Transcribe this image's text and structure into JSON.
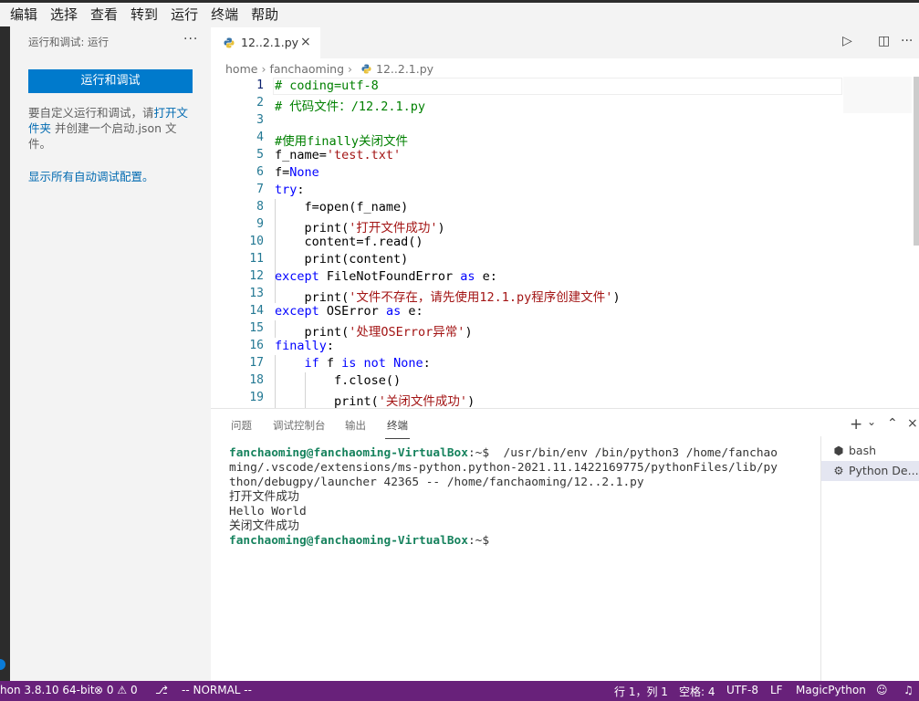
{
  "menu": [
    "编辑",
    "选择",
    "查看",
    "转到",
    "运行",
    "终端",
    "帮助"
  ],
  "sidebar": {
    "title": "运行和调试: 运行",
    "more": "···",
    "run_button": "运行和调试",
    "desc_pre": "要自定义运行和调试，请",
    "desc_link": "打开文件夹",
    "desc_post": " 并创建一个启动.json 文件。",
    "show_all": "显示所有自动调试配置。"
  },
  "tab": {
    "label": "12..2.1.py",
    "close": "×"
  },
  "editor_actions": {
    "run": "▷",
    "split": "◫",
    "more": "···"
  },
  "breadcrumb": {
    "home": "home",
    "user": "fanchaoming",
    "file": "12..2.1.py"
  },
  "editor": {
    "line_numbers": [
      "1",
      "2",
      "3",
      "4",
      "5",
      "6",
      "7",
      "8",
      "9",
      "10",
      "11",
      "12",
      "13",
      "14",
      "15",
      "16",
      "17",
      "18",
      "19"
    ],
    "lines": [
      [
        [
          "c-com",
          "# coding=utf-8"
        ]
      ],
      [
        [
          "c-com",
          "# 代码文件：/12.2.1.py"
        ]
      ],
      [],
      [
        [
          "c-com",
          "#使用finally关闭文件"
        ]
      ],
      [
        [
          "c-plain",
          "f_name="
        ],
        [
          "c-str",
          "'test.txt'"
        ]
      ],
      [
        [
          "c-plain",
          "f="
        ],
        [
          "c-kw",
          "None"
        ]
      ],
      [
        [
          "c-kw",
          "try"
        ],
        [
          "c-plain",
          ":"
        ]
      ],
      [
        [
          "c-plain",
          "    f=open(f_name)"
        ]
      ],
      [
        [
          "c-plain",
          "    print("
        ],
        [
          "c-str",
          "'打开文件成功'"
        ],
        [
          "c-plain",
          ")"
        ]
      ],
      [
        [
          "c-plain",
          "    content=f.read()"
        ]
      ],
      [
        [
          "c-plain",
          "    print(content)"
        ]
      ],
      [
        [
          "c-kw",
          "except"
        ],
        [
          "c-plain",
          " FileNotFoundError "
        ],
        [
          "c-kw",
          "as"
        ],
        [
          "c-plain",
          " e:"
        ]
      ],
      [
        [
          "c-plain",
          "    print("
        ],
        [
          "c-str",
          "'文件不存在，请先使用12.1.py程序创建文件'"
        ],
        [
          "c-plain",
          ")"
        ]
      ],
      [
        [
          "c-kw",
          "except"
        ],
        [
          "c-plain",
          " OSError "
        ],
        [
          "c-kw",
          "as"
        ],
        [
          "c-plain",
          " e:"
        ]
      ],
      [
        [
          "c-plain",
          "    print("
        ],
        [
          "c-str",
          "'处理OSError异常'"
        ],
        [
          "c-plain",
          ")"
        ]
      ],
      [
        [
          "c-kw",
          "finally"
        ],
        [
          "c-plain",
          ":"
        ]
      ],
      [
        [
          "c-plain",
          "    "
        ],
        [
          "c-kw",
          "if"
        ],
        [
          "c-plain",
          " f "
        ],
        [
          "c-kw",
          "is not"
        ],
        [
          "c-plain",
          " "
        ],
        [
          "c-kw",
          "None"
        ],
        [
          "c-plain",
          ":"
        ]
      ],
      [
        [
          "c-plain",
          "        f.close()"
        ]
      ],
      [
        [
          "c-plain",
          "        print("
        ],
        [
          "c-str",
          "'关闭文件成功'"
        ],
        [
          "c-plain",
          ")"
        ]
      ]
    ]
  },
  "panel": {
    "tabs": [
      "问题",
      "调试控制台",
      "输出",
      "终端"
    ],
    "actions": {
      "add": "+",
      "dropdown": "⌄",
      "maximize": "⌃",
      "close": "×"
    },
    "terminal": {
      "prompt_user": "fanchaoming@fanchaoming-VirtualBox",
      "prompt_suffix": ":~$",
      "cmd_1": "  /usr/bin/env /bin/python3 /home/fanchao",
      "cmd_2": "ming/.vscode/extensions/ms-python.python-2021.11.1422169775/pythonFiles/lib/py",
      "cmd_3": "thon/debugpy/launcher 42365 -- /home/fanchaoming/12..2.1.py",
      "out_1": "打开文件成功",
      "out_2": "Hello World",
      "out_3": "关闭文件成功"
    },
    "terminals": [
      {
        "icon": "terminal-icon",
        "label": "bash"
      },
      {
        "icon": "debug-icon",
        "label": "Python De..."
      }
    ]
  },
  "statusbar": {
    "python": "hon 3.8.10 64-bit",
    "errors": "0",
    "warnings": "0",
    "mode": "-- NORMAL --",
    "position": "行 1，列 1",
    "spaces": "空格: 4",
    "encoding": "UTF-8",
    "eol": "LF",
    "language": "MagicPython"
  }
}
